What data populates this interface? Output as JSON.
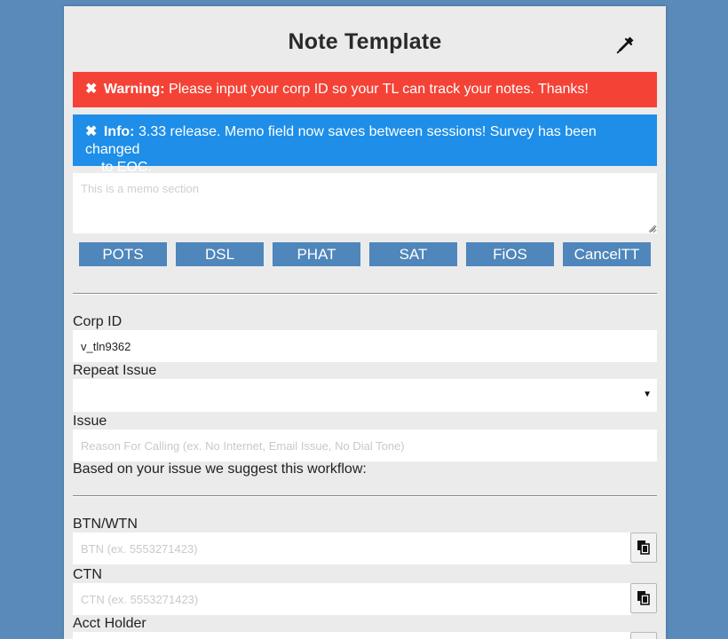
{
  "header": {
    "title": "Note Template"
  },
  "alerts": {
    "warning": {
      "label": "Warning:",
      "message": "Please input your corp ID so your TL can track your notes. Thanks!",
      "close": "✖"
    },
    "info": {
      "label": "Info:",
      "message_line1": "3.33 release. Memo field now saves between sessions! Survey has been changed",
      "message_line2": "to EOC.",
      "close": "✖"
    }
  },
  "memo": {
    "placeholder": "This is a memo section",
    "value": ""
  },
  "template_buttons": [
    "POTS",
    "DSL",
    "PHAT",
    "SAT",
    "FiOS",
    "CancelTT"
  ],
  "form": {
    "corp_id": {
      "label": "Corp ID",
      "value": "v_tln9362"
    },
    "repeat_issue": {
      "label": "Repeat Issue",
      "selected": ""
    },
    "issue": {
      "label": "Issue",
      "placeholder": "Reason For Calling (ex. No Internet, Email Issue, No Dial Tone)"
    },
    "workflow_text": "Based on your issue we suggest this workflow:",
    "btn_wtn": {
      "label": "BTN/WTN",
      "placeholder": "BTN (ex. 5553271423)"
    },
    "ctn": {
      "label": "CTN",
      "placeholder": "CTN (ex. 5553271423)"
    },
    "acct_holder": {
      "label": "Acct Holder"
    }
  },
  "icons": {
    "eyedropper": "eyedropper-icon",
    "copy": "clipboard-copy-icon",
    "close": "close-icon",
    "caret": "caret-down-icon"
  },
  "colors": {
    "background": "#5a8ab9",
    "panel": "#ebebeb",
    "warning": "#f44336",
    "info": "#1e8ee8",
    "button": "#4f86bb"
  }
}
